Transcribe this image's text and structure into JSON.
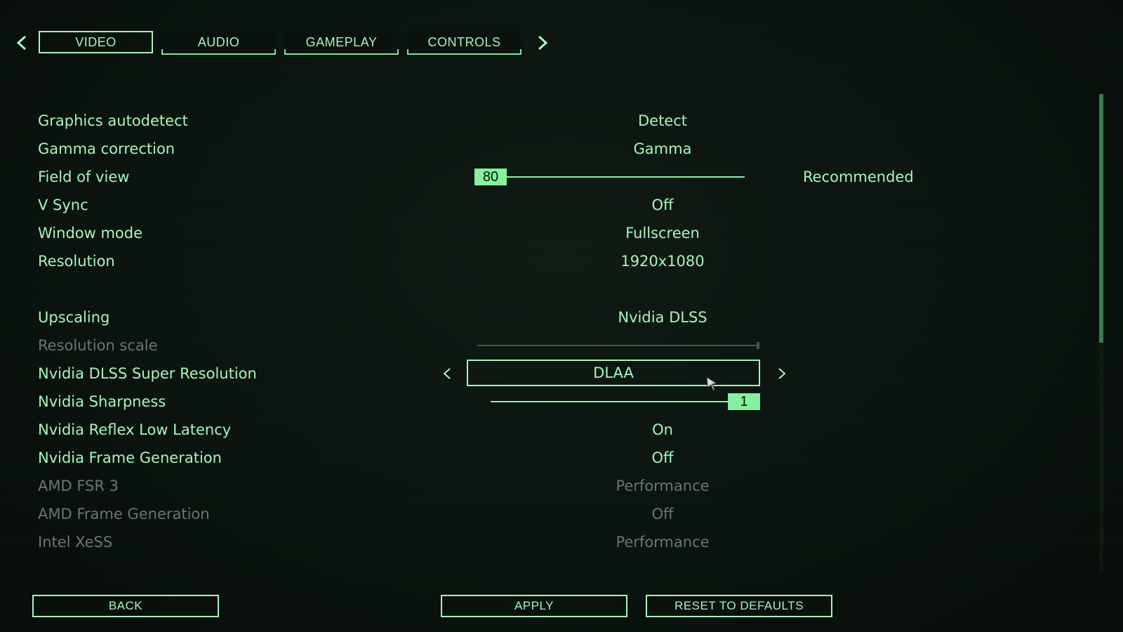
{
  "tabs": {
    "prev_icon": "chevron-left-icon",
    "next_icon": "chevron-right-icon",
    "items": [
      {
        "label": "VIDEO",
        "active": true
      },
      {
        "label": "AUDIO",
        "active": false
      },
      {
        "label": "GAMEPLAY",
        "active": false
      },
      {
        "label": "CONTROLS",
        "active": false
      }
    ]
  },
  "settings": {
    "graphics_autodetect": {
      "label": "Graphics autodetect",
      "value": "Detect"
    },
    "gamma_correction": {
      "label": "Gamma correction",
      "value": "Gamma"
    },
    "field_of_view": {
      "label": "Field of view",
      "value": "80",
      "extra": "Recommended"
    },
    "v_sync": {
      "label": "V Sync",
      "value": "Off"
    },
    "window_mode": {
      "label": "Window mode",
      "value": "Fullscreen"
    },
    "resolution": {
      "label": "Resolution",
      "value": "1920x1080"
    },
    "upscaling": {
      "label": "Upscaling",
      "value": "Nvidia DLSS"
    },
    "resolution_scale": {
      "label": "Resolution scale",
      "disabled": true,
      "level": 1.0
    },
    "dlss_super_resolution": {
      "label": "Nvidia DLSS Super Resolution",
      "value": "DLAA"
    },
    "nvidia_sharpness": {
      "label": "Nvidia Sharpness",
      "value": "1",
      "level": 1.0
    },
    "nvidia_reflex": {
      "label": "Nvidia Reflex Low Latency",
      "value": "On"
    },
    "nvidia_frame_generation": {
      "label": "Nvidia Frame Generation",
      "value": "Off"
    },
    "amd_fsr3": {
      "label": "AMD FSR 3",
      "value": "Performance",
      "disabled": true
    },
    "amd_frame_generation": {
      "label": "AMD Frame Generation",
      "value": "Off",
      "disabled": true
    },
    "intel_xess": {
      "label": "Intel XeSS",
      "value": "Performance",
      "disabled": true
    }
  },
  "buttons": {
    "back": "BACK",
    "apply": "APPLY",
    "reset": "RESET TO DEFAULTS"
  },
  "colors": {
    "accent": "#a8f5bb",
    "disabled": "#6a7670",
    "background": "#0a120d"
  }
}
